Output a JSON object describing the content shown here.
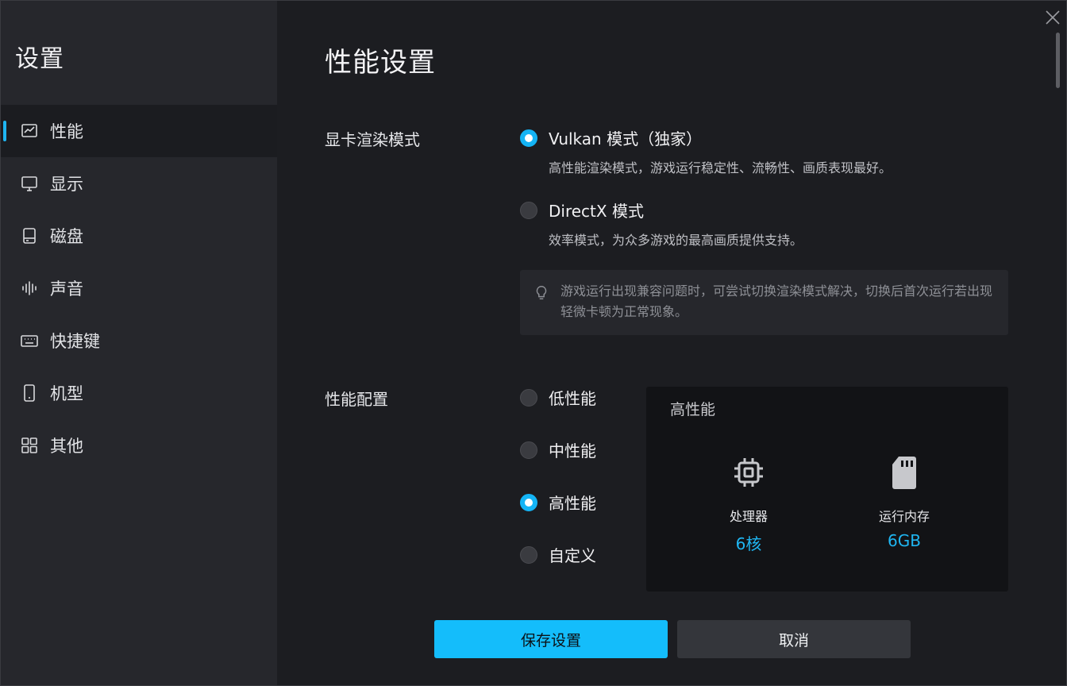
{
  "sidebar": {
    "title": "设置",
    "items": [
      {
        "label": "性能",
        "icon": "chart-icon",
        "active": true
      },
      {
        "label": "显示",
        "icon": "monitor-icon",
        "active": false
      },
      {
        "label": "磁盘",
        "icon": "disk-icon",
        "active": false
      },
      {
        "label": "声音",
        "icon": "sound-wave-icon",
        "active": false
      },
      {
        "label": "快捷键",
        "icon": "keyboard-icon",
        "active": false
      },
      {
        "label": "机型",
        "icon": "phone-icon",
        "active": false
      },
      {
        "label": "其他",
        "icon": "grid-icon",
        "active": false
      }
    ]
  },
  "main": {
    "title": "性能设置",
    "render_mode": {
      "label": "显卡渲染模式",
      "options": [
        {
          "label": "Vulkan 模式（独家）",
          "desc": "高性能渲染模式，游戏运行稳定性、流畅性、画质表现最好。",
          "checked": true
        },
        {
          "label": "DirectX 模式",
          "desc": "效率模式，为众多游戏的最高画质提供支持。",
          "checked": false
        }
      ],
      "tip": "游戏运行出现兼容问题时，可尝试切换渲染模式解决，切换后首次运行若出现轻微卡顿为正常现象。"
    },
    "performance": {
      "label": "性能配置",
      "options": [
        {
          "label": "低性能",
          "checked": false
        },
        {
          "label": "中性能",
          "checked": false
        },
        {
          "label": "高性能",
          "checked": true
        },
        {
          "label": "自定义",
          "checked": false
        }
      ],
      "panel": {
        "title": "高性能",
        "cpu": {
          "name": "处理器",
          "value": "6核",
          "icon": "cpu-icon"
        },
        "ram": {
          "name": "运行内存",
          "value": "6GB",
          "icon": "memory-card-icon"
        }
      }
    },
    "buttons": {
      "save": "保存设置",
      "cancel": "取消"
    }
  },
  "colors": {
    "accent": "#14b4f5",
    "sidebar_bg": "#26272c",
    "main_bg": "#1c1d21",
    "panel_bg": "#121316"
  }
}
